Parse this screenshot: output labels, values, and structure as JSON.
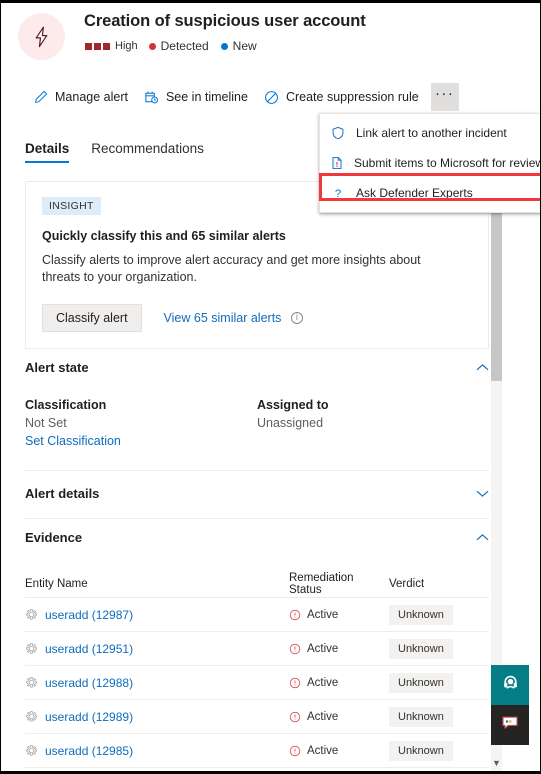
{
  "header": {
    "icon": "lightning-bolt-icon",
    "title": "Creation of suspicious user account",
    "severity_label": "High",
    "severity_color": "#a4262c",
    "detection_status": "Detected",
    "detection_color": "#d13438",
    "state": "New",
    "state_color": "#0078d4"
  },
  "commandbar": {
    "items": [
      {
        "label": "Manage alert",
        "icon": "pencil-icon"
      },
      {
        "label": "See in timeline",
        "icon": "timeline-icon"
      },
      {
        "label": "Create suppression rule",
        "icon": "block-icon"
      }
    ],
    "more_label": "···",
    "more_name": "more-actions-button"
  },
  "menu": {
    "items": [
      {
        "label": "Link alert to another incident",
        "icon": "shield-icon",
        "highlighted": false
      },
      {
        "label": "Submit items to Microsoft for review",
        "icon": "document-alert-icon",
        "highlighted": false
      },
      {
        "label": "Ask Defender Experts",
        "icon": "question-mark-icon",
        "highlighted": true
      }
    ],
    "highlight_color": "#ee3a3a"
  },
  "tabs": [
    {
      "label": "Details",
      "active": true
    },
    {
      "label": "Recommendations",
      "active": false
    }
  ],
  "insight": {
    "badge": "INSIGHT",
    "title": "Quickly classify this and 65 similar alerts",
    "description": "Classify alerts to improve alert accuracy and get more insights about threats to your organization.",
    "primary_button": "Classify alert",
    "link": "View 65 similar alerts",
    "info_icon": "info-icon"
  },
  "sections": {
    "alert_state": {
      "title": "Alert state",
      "expanded": true,
      "chevron": "chevron-up-icon",
      "classification_label": "Classification",
      "classification_value": "Not Set",
      "classification_link": "Set Classification",
      "assigned_label": "Assigned to",
      "assigned_value": "Unassigned"
    },
    "alert_details": {
      "title": "Alert details",
      "expanded": false,
      "chevron": "chevron-down-icon"
    },
    "evidence": {
      "title": "Evidence",
      "expanded": true,
      "chevron": "chevron-up-icon",
      "columns": [
        "Entity Name",
        "Remediation Status",
        "Verdict"
      ],
      "rows": [
        {
          "entity": "useradd (12987)",
          "status": "Active",
          "verdict": "Unknown"
        },
        {
          "entity": "useradd (12951)",
          "status": "Active",
          "verdict": "Unknown"
        },
        {
          "entity": "useradd (12988)",
          "status": "Active",
          "verdict": "Unknown"
        },
        {
          "entity": "useradd (12989)",
          "status": "Active",
          "verdict": "Unknown"
        },
        {
          "entity": "useradd (12985)",
          "status": "Active",
          "verdict": "Unknown"
        }
      ]
    }
  },
  "side_buttons": [
    {
      "name": "support-button",
      "icon": "headset-icon",
      "color": "#047e84"
    },
    {
      "name": "feedback-button",
      "icon": "chat-icon",
      "color": "#252423"
    }
  ],
  "scrollbar": {
    "down_arrow": "▼"
  }
}
